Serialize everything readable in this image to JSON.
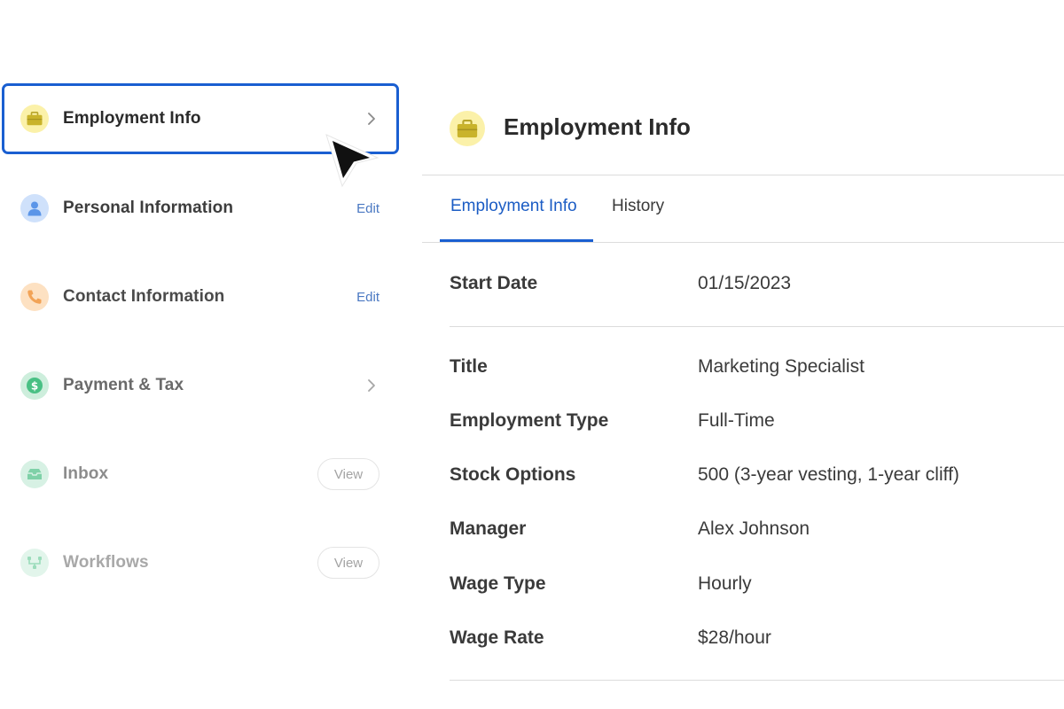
{
  "sidebar": {
    "items": [
      {
        "label": "Employment Info",
        "icon": "briefcase-icon",
        "icon_bg": "#fbf1a9",
        "icon_color": "#c9b32b",
        "action": "chevron",
        "active": true,
        "label_color": "#2a2a2a"
      },
      {
        "label": "Personal Information",
        "icon": "person-icon",
        "icon_bg": "#cfe1fb",
        "icon_color": "#5b95e8",
        "action": "link",
        "action_label": "Edit",
        "label_color": "#3d3d3d"
      },
      {
        "label": "Contact Information",
        "icon": "phone-icon",
        "icon_bg": "#fde1c2",
        "icon_color": "#f2a356",
        "action": "link",
        "action_label": "Edit",
        "label_color": "#4a4a4a"
      },
      {
        "label": "Payment & Tax",
        "icon": "dollar-icon",
        "icon_bg": "#cdeedc",
        "icon_color": "#49c084",
        "action": "chevron",
        "label_color": "#6a6a6a"
      },
      {
        "label": "Inbox",
        "icon": "inbox-icon",
        "icon_bg": "#d7f1e4",
        "icon_color": "#7fd1a8",
        "action": "pill",
        "action_label": "View",
        "label_color": "#8c8c8c"
      },
      {
        "label": "Workflows",
        "icon": "workflow-icon",
        "icon_bg": "#e2f5eb",
        "icon_color": "#9bdcbb",
        "action": "pill",
        "action_label": "View",
        "label_color": "#a8a8a8"
      }
    ]
  },
  "main": {
    "title": "Employment Info",
    "header_icon": "briefcase-icon",
    "tabs": [
      {
        "label": "Employment Info",
        "active": true
      },
      {
        "label": "History",
        "active": false
      }
    ],
    "start_date": {
      "label": "Start Date",
      "value": "01/15/2023"
    },
    "fields": [
      {
        "label": "Title",
        "value": "Marketing Specialist"
      },
      {
        "label": "Employment Type",
        "value": "Full-Time"
      },
      {
        "label": "Stock Options",
        "value": "500 (3-year vesting, 1-year cliff)"
      },
      {
        "label": "Manager",
        "value": "Alex Johnson"
      },
      {
        "label": "Wage Type",
        "value": "Hourly"
      },
      {
        "label": "Wage Rate",
        "value": "$28/hour"
      }
    ]
  },
  "colors": {
    "accent": "#1a5fd1",
    "active_tab_text": "#1b5cc4",
    "link": "#4a78c2"
  }
}
